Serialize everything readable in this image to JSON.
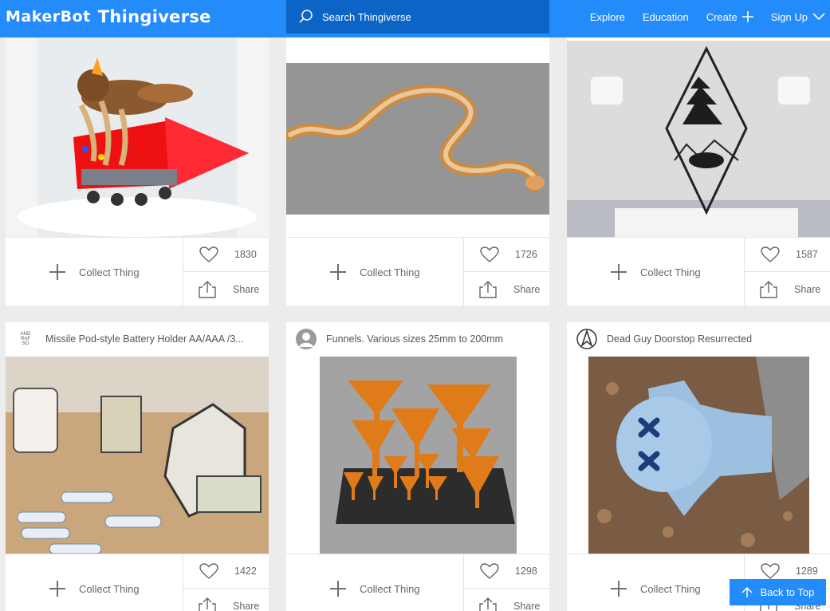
{
  "header": {
    "logo_maker": "MakerBot",
    "logo_thingiverse": "Thingiverse",
    "search_placeholder": "Search Thingiverse",
    "nav": [
      "Explore",
      "Education",
      "Create",
      "Sign Up"
    ]
  },
  "cards": [
    {
      "title": "",
      "likes": "1830",
      "collect_label": "Collect Thing",
      "share_label": "Share"
    },
    {
      "title": "",
      "likes": "1726",
      "collect_label": "Collect Thing",
      "share_label": "Share"
    },
    {
      "title": "",
      "likes": "1587",
      "collect_label": "Collect Thing",
      "share_label": "Share"
    },
    {
      "title": "Missile Pod-style Battery Holder AA/AAA /3...",
      "likes": "1422",
      "collect_label": "Collect Thing",
      "share_label": "Share",
      "avatar_text": [
        "AND",
        "RAF",
        "SO"
      ]
    },
    {
      "title": "Funnels. Various sizes 25mm to 200mm",
      "likes": "1298",
      "collect_label": "Collect Thing",
      "share_label": "Share"
    },
    {
      "title": "Dead Guy Doorstop Resurrected",
      "likes": "1289",
      "collect_label": "Collect Thing",
      "share_label": "Share"
    }
  ],
  "back_to_top": "Back to Top",
  "colors": {
    "brand": "#248bfb",
    "search_bg": "#0d64c7"
  }
}
